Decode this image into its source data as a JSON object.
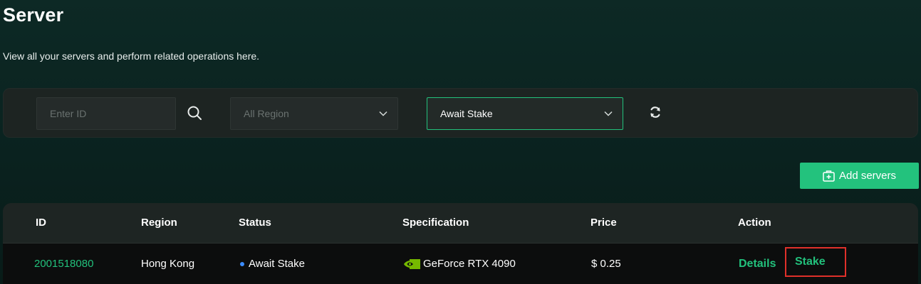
{
  "header": {
    "title": "Server",
    "subtitle": "View all your servers and perform related operations here."
  },
  "filters": {
    "id_placeholder": "Enter ID",
    "region_value": "All Region",
    "status_value": "Await Stake"
  },
  "toolbar": {
    "add_label": "Add servers"
  },
  "table": {
    "columns": [
      "ID",
      "Region",
      "Status",
      "Specification",
      "Price",
      "Action"
    ],
    "rows": [
      {
        "id": "2001518080",
        "region": "Hong Kong",
        "status": "Await Stake",
        "specification": "GeForce RTX 4090",
        "price": "$ 0.25",
        "actions": [
          "Details",
          "Stake"
        ]
      }
    ]
  },
  "colors": {
    "accent": "#22c17c",
    "status_dot": "#3b8cff",
    "highlight_box": "#e0302a"
  },
  "icons": {
    "search": "search-icon",
    "chevron": "chevron-down-icon",
    "refresh": "refresh-icon",
    "add": "add-box-icon",
    "gpu": "nvidia-logo-icon"
  }
}
